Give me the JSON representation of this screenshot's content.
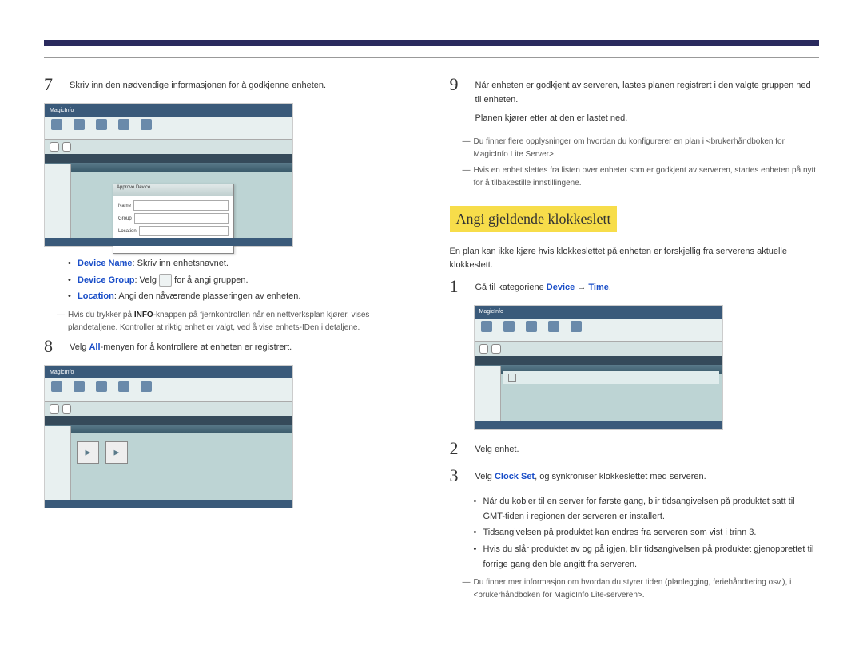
{
  "left": {
    "step7": {
      "num": "7",
      "text": "Skriv inn den nødvendige informasjonen for å godkjenne enheten."
    },
    "bullets7": {
      "b1_label": "Device Name",
      "b1_text": ": Skriv inn enhetsnavnet.",
      "b2_label": "Device Group",
      "b2_text_before": ": Velg ",
      "b2_text_after": " for å angi gruppen.",
      "b3_label": "Location",
      "b3_text": ": Angi den nåværende plasseringen av enheten."
    },
    "note7": {
      "pre": "Hvis du trykker på ",
      "bold": "INFO",
      "post": "-knappen på fjernkontrollen når en nettverksplan kjører, vises plandetaljene. Kontroller at riktig enhet er valgt, ved å vise enhets-IDen i detaljene."
    },
    "step8": {
      "num": "8",
      "pre": "Velg ",
      "kw": "All",
      "post": "-menyen for å kontrollere at enheten er registrert."
    }
  },
  "right": {
    "step9": {
      "num": "9",
      "line1": "Når enheten er godkjent av serveren, lastes planen registrert i den valgte gruppen ned til enheten.",
      "line2": "Planen kjører etter at den er lastet ned."
    },
    "note9a": "Du finner flere opplysninger om hvordan du konfigurerer en plan i <brukerhåndboken for MagicInfo Lite Server>.",
    "note9b": "Hvis en enhet slettes fra listen over enheter som er godkjent av serveren, startes enheten på nytt for å tilbakestille innstillingene.",
    "heading": "Angi gjeldende klokkeslett",
    "intro": "En plan kan ikke kjøre hvis klokkeslettet på enheten er forskjellig fra serverens aktuelle klokkeslett.",
    "step1": {
      "num": "1",
      "pre": "Gå til kategoriene ",
      "kw1": "Device",
      "arrow": " → ",
      "kw2": "Time",
      "post": "."
    },
    "step2": {
      "num": "2",
      "text": "Velg enhet."
    },
    "step3": {
      "num": "3",
      "pre": "Velg ",
      "kw": "Clock Set",
      "post": ", og synkroniser klokkeslettet med serveren."
    },
    "bullets3": {
      "b1": "Når du kobler til en server for første gang, blir tidsangivelsen på produktet satt til GMT-tiden i regionen der serveren er installert.",
      "b2": "Tidsangivelsen på produktet kan endres fra serveren som vist i trinn 3.",
      "b3": "Hvis du slår produktet av og på igjen, blir tidsangivelsen på produktet gjenopprettet til forrige gang den ble angitt fra serveren."
    },
    "note_final": "Du finner mer informasjon om hvordan du styrer tiden (planlegging, feriehåndtering osv.), i <brukerhåndboken for MagicInfo Lite-serveren>."
  },
  "screenshot_labels": {
    "logo": "MagicInfo",
    "dialog_title": "Approve Device"
  }
}
